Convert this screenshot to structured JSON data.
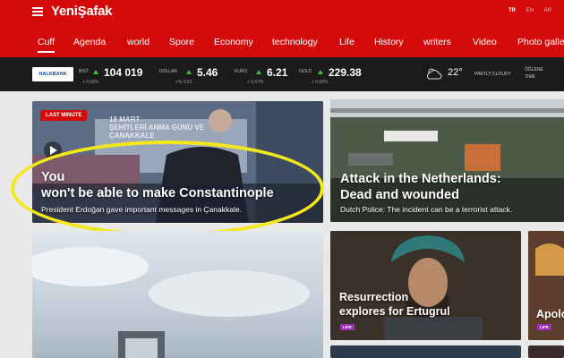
{
  "header": {
    "logo": "YeniŞafak",
    "languages": [
      "TR",
      "EN",
      "AR"
    ],
    "active_language": "TR"
  },
  "nav": {
    "items": [
      "Cuff",
      "Agenda",
      "world",
      "Spore",
      "Economy",
      "technology",
      "Life",
      "History",
      "writers",
      "Video",
      "Photo galle"
    ],
    "active": "Cuff"
  },
  "ticker": {
    "bank": "HALKBANK",
    "items": [
      {
        "label": "BIST",
        "value": "104 019",
        "change": "+ 0,68%"
      },
      {
        "label": "DOLLAR",
        "value": "5.46",
        "change": "+% 0,53"
      },
      {
        "label": "EURO",
        "value": "6.21",
        "change": "+ 0,67%"
      },
      {
        "label": "GOLD",
        "value": "229.38",
        "change": "+ 0,68%"
      }
    ],
    "weather": {
      "temp": "22",
      "unit": "°",
      "desc": "PARTLY CLOUDY"
    },
    "time_label_1": "ÖĞLENE",
    "time_label_2": "TIME"
  },
  "cards": {
    "main": {
      "badge": "LAST MINUTE",
      "title_line1": "You",
      "title_line2": "won't be able to make Constantinople",
      "subtitle": "President Erdoğan gave important messages in Çanakkale.",
      "banner_line1": "18 MART",
      "banner_line2": "ŞEHİTLERİ ANMA GÜNÜ VE",
      "banner_line3": "ÇANAKKALE"
    },
    "netherlands": {
      "title_line1": "Attack in the Netherlands:",
      "title_line2": "Dead and wounded",
      "subtitle": "Dutch Police: The incident can be a terrorist attack."
    },
    "resurrection": {
      "title_line1": "Resurrection",
      "title_line2": "explores for Ertugrul",
      "badge": "LIFE"
    },
    "apolo": {
      "title": "Apolo",
      "badge": "LIFE"
    }
  },
  "colors": {
    "brand": "#d40a0a",
    "highlight": "#f4e81a",
    "life_badge": "#9b2fb6"
  }
}
